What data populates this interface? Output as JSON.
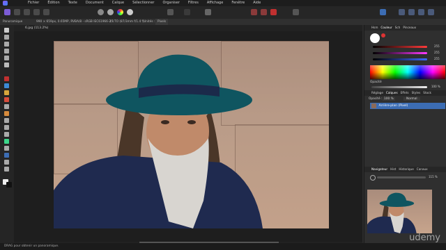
{
  "menubar": {
    "items": [
      "Fichier",
      "Édition",
      "Texte",
      "Document",
      "Calque",
      "Sélectionner",
      "Organiser",
      "Filtres",
      "Affichage",
      "Fenêtre",
      "Aide"
    ]
  },
  "context_bar": {
    "label": "Panoramique",
    "size": "990 × 659px, 0.65MP, RVBA/8 - sRGB IEC61966-2.1",
    "camera": "f/-:TO (87/3mm f/1.4 f)",
    "units_label": "Unités :",
    "units_value": "Pixels"
  },
  "document_tab": {
    "title": "6.jpg (113.2%)"
  },
  "panels": {
    "color_tabs": [
      "Hsm",
      "Couleur",
      "Sch",
      "Pinceaux"
    ],
    "opacity_label": "Opacité",
    "opacity_value": "100 %",
    "rgb_values": [
      "255",
      "255",
      "255"
    ],
    "layers_tabs": [
      "Réglage",
      "Calques",
      "Effets",
      "Styles",
      "Stock"
    ],
    "opacity_field_label": "Opacité :",
    "opacity_field_value": "100 %",
    "blend_mode": "Normal",
    "layer_name": "Arrière-plan (Pixel)",
    "nav_tabs": [
      "Navigateur",
      "Hist",
      "Historique",
      "Canaux"
    ],
    "zoom_value": "115 %"
  },
  "statusbar": {
    "text": "DRAG pour obtenir un panoramique."
  },
  "watermark": {
    "text": "udemy"
  },
  "colors": {
    "accent": "#3c6db4",
    "background": "#2b2b2b"
  }
}
